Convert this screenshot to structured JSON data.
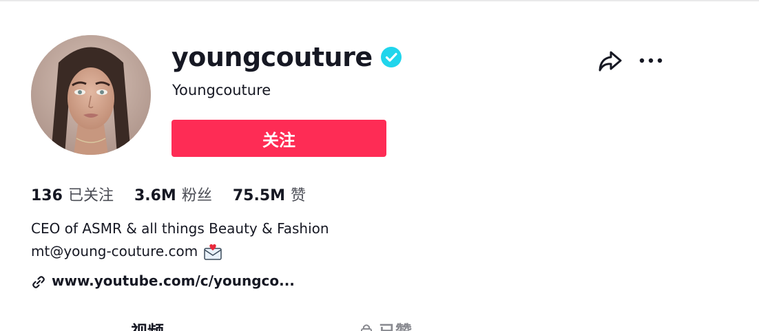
{
  "profile": {
    "username": "youngcouture",
    "nickname": "Youngcouture",
    "verified": true,
    "follow_label": "关注"
  },
  "stats": {
    "following_count": "136",
    "following_label": "已关注",
    "followers_count": "3.6M",
    "followers_label": "粉丝",
    "likes_count": "75.5M",
    "likes_label": "赞"
  },
  "bio": {
    "line1": "CEO of ASMR & all things Beauty & Fashion",
    "line2": "mt@young-couture.com",
    "line2_icon": "envelope-heart-icon"
  },
  "link": {
    "text": "www.youtube.com/c/youngco...",
    "icon": "link-icon"
  },
  "tabs": [
    {
      "label": "视频"
    },
    {
      "label": "已赞",
      "icon": "lock-icon"
    }
  ],
  "actions": {
    "share_icon": "share-icon",
    "more_icon": "more-icon"
  },
  "colors": {
    "accent": "#fe2c55",
    "verified": "#20d5ec",
    "text": "#161823",
    "secondary_text": "#4b4d55"
  }
}
